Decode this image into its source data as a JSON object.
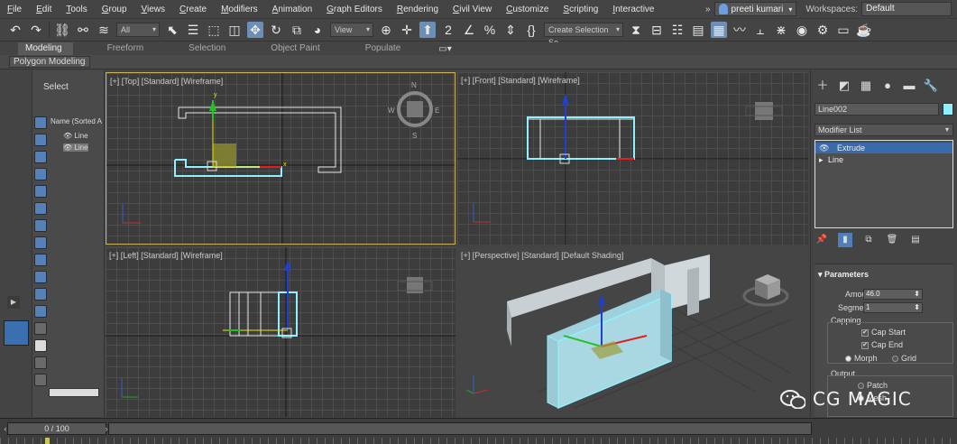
{
  "menu": [
    "File",
    "Edit",
    "Tools",
    "Group",
    "Views",
    "Create",
    "Modifiers",
    "Animation",
    "Graph Editors",
    "Rendering",
    "Civil View",
    "Customize",
    "Scripting",
    "Interactive"
  ],
  "user": "preeti kumari",
  "workspaces_label": "Workspaces:",
  "workspace": "Default",
  "toolbar": {
    "filter": "All",
    "ref_coord": "View",
    "selection_set": "Create Selection Se"
  },
  "ribbon": {
    "tabs": [
      "Modeling",
      "Freeform",
      "Selection",
      "Object Paint",
      "Populate"
    ],
    "active_tab": "Modeling",
    "sub_chip": "Polygon Modeling"
  },
  "scene": {
    "title": "Select",
    "name_header": "Name (Sorted A",
    "rows": [
      "Line",
      "Line"
    ]
  },
  "viewports": {
    "top": "[+] [Top] [Standard] [Wireframe]",
    "front": "[+] [Front] [Standard] [Wireframe]",
    "left": "[+] [Left] [Standard] [Wireframe]",
    "perspective": "[+] [Perspective] [Standard] [Default Shading]",
    "compass": {
      "n": "N",
      "s": "S",
      "e": "E",
      "w": "W"
    }
  },
  "command_panel": {
    "object_name": "Line002",
    "object_color": "#8ff0ff",
    "modifier_list": "Modifier List",
    "stack": [
      "Extrude",
      "Line"
    ],
    "params_title": "Parameters",
    "amount_label": "Amount:",
    "amount": "46.0",
    "segments_label": "Segments:",
    "segments": "1",
    "capping_label": "Capping",
    "cap_start": "Cap Start",
    "cap_end": "Cap End",
    "morph": "Morph",
    "grid": "Grid",
    "output_label": "Output",
    "patch": "Patch",
    "mesh": "Mesh"
  },
  "timeline": {
    "frame": "0 / 100"
  },
  "watermark": "CG MAGIC"
}
